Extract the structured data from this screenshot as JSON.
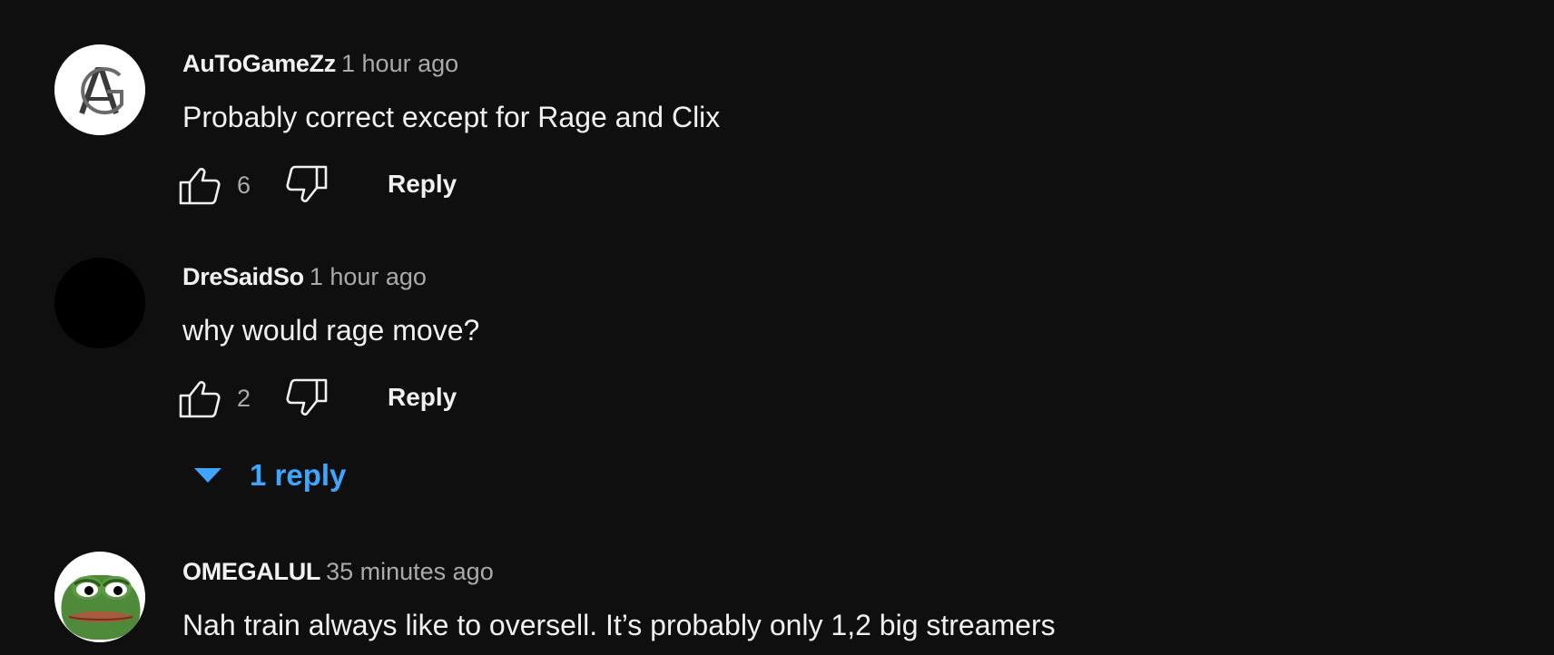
{
  "comments": [
    {
      "author": "AuToGameZz",
      "time": "1 hour ago",
      "text": "Probably correct except for Rage and Clix",
      "likes": "6",
      "reply_label": "Reply",
      "avatar": "ag-logo-avatar"
    },
    {
      "author": "DreSaidSo",
      "time": "1 hour ago",
      "text": "why would rage move?",
      "likes": "2",
      "reply_label": "Reply",
      "avatar": "black-circle-avatar",
      "replies_label": "1 reply"
    },
    {
      "author": "OMEGALUL",
      "time": "35 minutes ago",
      "text": "Nah train always like to oversell. It’s probably only 1,2 big streamers",
      "avatar": "pepe-frog-avatar"
    }
  ],
  "icons": {
    "like": "thumbs-up-outline-icon",
    "dislike": "thumbs-down-outline-icon",
    "replies_toggle": "caret-down-icon"
  },
  "colors": {
    "background": "#0f0f0f",
    "primary_text": "#f1f1f1",
    "secondary_text": "#aaaaaa",
    "link_blue": "#3ea6ff"
  }
}
